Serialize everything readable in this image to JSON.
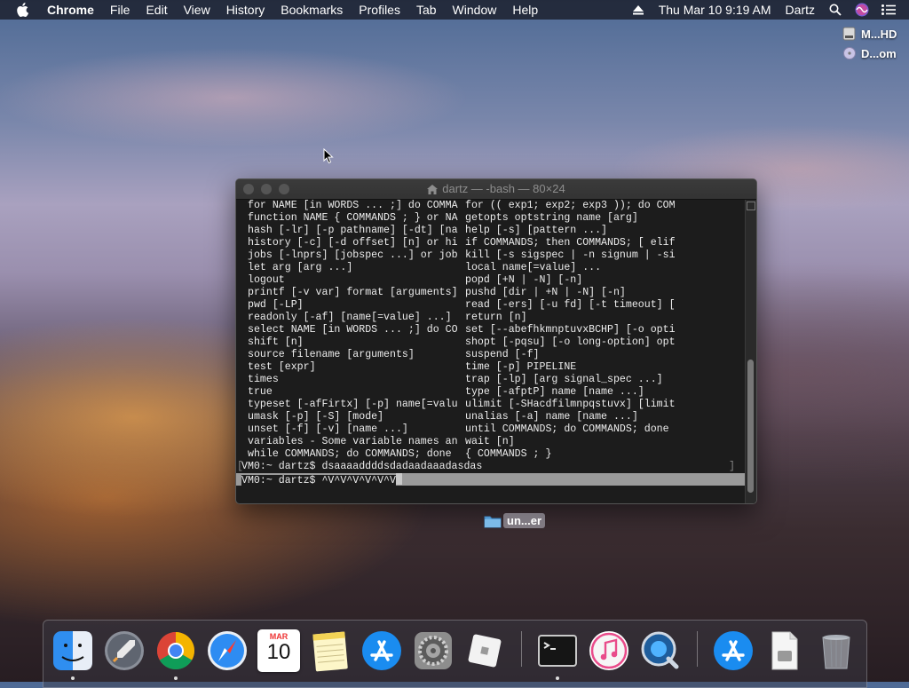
{
  "menubar": {
    "apple_icon": "apple-logo",
    "app_name": "Chrome",
    "items": [
      "File",
      "Edit",
      "View",
      "History",
      "Bookmarks",
      "Profiles",
      "Tab",
      "Window",
      "Help"
    ],
    "clock": "Thu Mar 10  9:19 AM",
    "user": "Dartz",
    "status_icons": [
      "eject-icon",
      "spotlight-search-icon",
      "siri-icon",
      "notification-center-icon"
    ]
  },
  "desktop": {
    "items": [
      {
        "label": "M...HD",
        "icon": "hard-drive-icon"
      },
      {
        "label": "D...om",
        "icon": "disk-image-icon"
      }
    ],
    "folder": {
      "label": "un...er",
      "icon": "folder-icon"
    }
  },
  "terminal": {
    "title": "dartz — -bash — 80×24",
    "left_col": [
      "for NAME [in WORDS ... ;] do COMMA",
      "function NAME { COMMANDS ; } or NA",
      "hash [-lr] [-p pathname] [-dt] [na",
      "history [-c] [-d offset] [n] or hi",
      "jobs [-lnprs] [jobspec ...] or job",
      "let arg [arg ...]",
      "logout",
      "printf [-v var] format [arguments]",
      "pwd [-LP]",
      "readonly [-af] [name[=value] ...]",
      "select NAME [in WORDS ... ;] do CO",
      "shift [n]",
      "source filename [arguments]",
      "test [expr]",
      "times",
      "true",
      "typeset [-afFirtx] [-p] name[=valu",
      "umask [-p] [-S] [mode]",
      "unset [-f] [-v] [name ...]",
      "variables - Some variable names an",
      "while COMMANDS; do COMMANDS; done"
    ],
    "right_col": [
      "for (( exp1; exp2; exp3 )); do COM",
      "getopts optstring name [arg]",
      "help [-s] [pattern ...]",
      "if COMMANDS; then COMMANDS; [ elif",
      "kill [-s sigspec | -n signum | -si",
      "local name[=value] ...",
      "popd [+N | -N] [-n]",
      "pushd [dir | +N | -N] [-n]",
      "read [-ers] [-u fd] [-t timeout] [",
      "return [n]",
      "set [--abefhkmnptuvxBCHP] [-o opti",
      "shopt [-pqsu] [-o long-option] opt",
      "suspend [-f]",
      "time [-p] PIPELINE",
      "trap [-lp] [arg signal_spec ...]",
      "type [-afptP] name [name ...]",
      "ulimit [-SHacdfilmnpqstuvx] [limit",
      "unalias [-a] name [name ...]",
      "until COMMANDS; do COMMANDS; done",
      "wait [n]",
      "{ COMMANDS ; }"
    ],
    "prompt1": "VM0:~ dartz$ dsaaaaddddsdadaadaaadasdas",
    "prompt2_prefix": "VM0:~ dartz$ ",
    "prompt2_input": "^V^V^V^V^V^V"
  },
  "dock": {
    "apps": [
      {
        "name": "Finder",
        "icon": "finder-icon",
        "running": true
      },
      {
        "name": "Launchpad",
        "icon": "launchpad-icon",
        "running": false
      },
      {
        "name": "Google Chrome",
        "icon": "chrome-icon",
        "running": true
      },
      {
        "name": "Safari",
        "icon": "safari-icon",
        "running": false
      },
      {
        "name": "Calendar",
        "icon": "calendar-icon",
        "running": false,
        "month": "MAR",
        "day": "10"
      },
      {
        "name": "Notes",
        "icon": "notes-icon",
        "running": false
      },
      {
        "name": "App Store",
        "icon": "app-store-icon",
        "running": false
      },
      {
        "name": "System Preferences",
        "icon": "system-preferences-icon",
        "running": false
      },
      {
        "name": "Roblox",
        "icon": "roblox-icon",
        "running": false
      },
      {
        "name": "Terminal",
        "icon": "terminal-icon",
        "running": true
      },
      {
        "name": "iTunes",
        "icon": "itunes-icon",
        "running": false
      },
      {
        "name": "QuickTime Player",
        "icon": "quicktime-icon",
        "running": false
      },
      {
        "name": "App Store Downloads",
        "icon": "app-store-downloads-icon",
        "running": false
      },
      {
        "name": "Document",
        "icon": "document-stack-icon",
        "running": false
      },
      {
        "name": "Trash",
        "icon": "trash-icon",
        "running": false
      }
    ]
  }
}
